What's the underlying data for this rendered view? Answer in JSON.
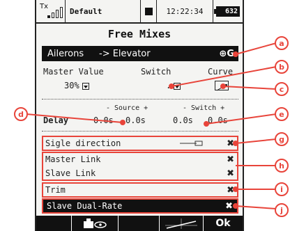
{
  "status": {
    "tx_label": "Tx",
    "model_name": "Default",
    "time": "12:22:34",
    "battery": "632"
  },
  "title": "Free Mixes",
  "mix": {
    "source": "Ailerons",
    "target": "-> Elevator",
    "badge": "⊕G"
  },
  "master_value": {
    "label": "Master Value",
    "value": "30%"
  },
  "switch": {
    "label": "Switch",
    "value": "."
  },
  "curve": {
    "label": "Curve"
  },
  "delay": {
    "source_header": "- Source +",
    "switch_header": "- Switch +",
    "label": "Delay",
    "source_minus": "0.0s",
    "source_plus": "0.0s",
    "switch_minus": "0.0s",
    "switch_plus": "0.0s"
  },
  "options": {
    "single_direction": "Sigle direction",
    "master_link": "Master Link",
    "slave_link": "Slave Link",
    "trim": "Trim",
    "slave_dual_rate": "Slave Dual-Rate",
    "cross": "✖"
  },
  "softkeys": {
    "ok": "Ok"
  },
  "callouts": [
    "a",
    "b",
    "c",
    "d",
    "e",
    "g",
    "h",
    "i",
    "j"
  ],
  "colors": {
    "accent": "#e8443a",
    "screen_bg": "#f4f4f2",
    "dark": "#111111"
  }
}
